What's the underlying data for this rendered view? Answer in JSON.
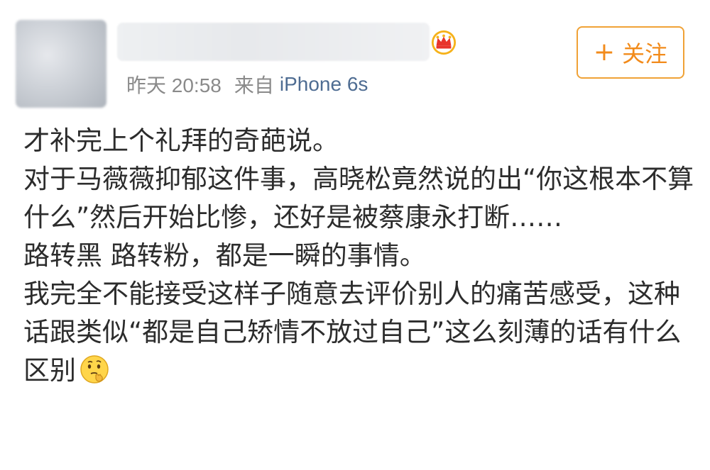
{
  "post": {
    "meta": {
      "time": "昨天 20:58",
      "source_prefix": "来自",
      "source_device": "iPhone 6s"
    },
    "follow_button": {
      "icon": "plus-icon",
      "label": "关注"
    },
    "badge_icon": "crown-icon",
    "content": {
      "paragraphs": [
        "才补完上个礼拜的奇葩说。",
        "对于马薇薇抑郁这件事，高晓松竟然说的出“你这根本不算什么”然后开始比惨，还好是被蔡康永打断……",
        "路转黑 路转粉，都是一瞬的事情。",
        "我完全不能接受这样子随意去评价别人的痛苦感受，这种话跟类似“都是自己矫情不放过自己”这么刻薄的话有什么区别"
      ],
      "trailing_emoji": "thinking-face-icon"
    }
  },
  "colors": {
    "accent": "#f28b1b",
    "link": "#4e6c92",
    "meta_gray": "#8a8a8a",
    "text": "#2c2c2c"
  }
}
